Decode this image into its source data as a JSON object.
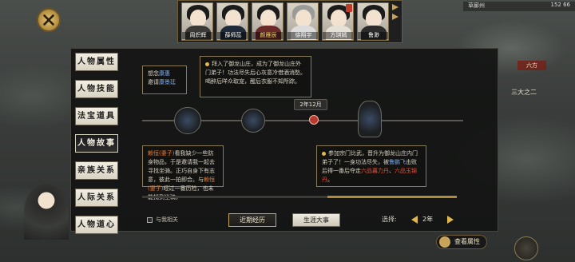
{
  "top": {
    "portraits": [
      {
        "name": "周炽辉",
        "selected": false
      },
      {
        "name": "薛师蕊",
        "selected": false
      },
      {
        "name": "颜雁辰",
        "selected": true
      },
      {
        "name": "徐翔宇",
        "selected": false
      },
      {
        "name": "方琪嫣",
        "selected": false
      },
      {
        "name": "鲁渺",
        "selected": false
      }
    ],
    "status_left": "草廊州",
    "status_right": "152 66"
  },
  "map": {
    "region_label": "六方",
    "region_sub": "三大之二"
  },
  "tabs": [
    {
      "label": "人物属性",
      "active": false
    },
    {
      "label": "人物技能",
      "active": false
    },
    {
      "label": "法宝道具",
      "active": false
    },
    {
      "label": "人物故事",
      "active": true
    },
    {
      "label": "亲族关系",
      "active": false
    },
    {
      "label": "人际关系",
      "active": false
    },
    {
      "label": "人物道心",
      "active": false
    }
  ],
  "story": {
    "date": "2年12月",
    "card_top_left": {
      "line1": "想念",
      "name1": "康惠",
      "line2": "邀请",
      "name2": "康景廷"
    },
    "card_top_right": {
      "text": "拜入了御龙山庄，成为了御龙山庄外门弟子！功法尽失后心灰意冷借酒消愁。喝醉后咩众取宠，醒后衣服不知所踪。"
    },
    "card_bottom_left": {
      "pre": "赖恒(妻子)",
      "mid": "看我缺少一些防身物品，于是邀请我一起去寻找坐骑。正巧自身下有志意，彼此一拍即合。与",
      "name2": "赖恒(妻子)",
      "post": "经过一番历险，也未能找到坐骑。"
    },
    "card_bottom_right": {
      "pre": "参加宗门比武，晋升为御龙山庄内门弟子了！一身功法尽失，被",
      "name1": "鲁鹏飞",
      "mid": "击败后得一番后夺走",
      "name2": "六品暮力丹",
      "sep": "、",
      "name3": "六品玉锦丹",
      "post": "。"
    }
  },
  "controls": {
    "checkbox_label": "与我相关",
    "btn_recent": "近期经历",
    "btn_life": "生涯大事",
    "select_label": "选择:",
    "year_value": "2年",
    "view_attr": "查看属性"
  }
}
